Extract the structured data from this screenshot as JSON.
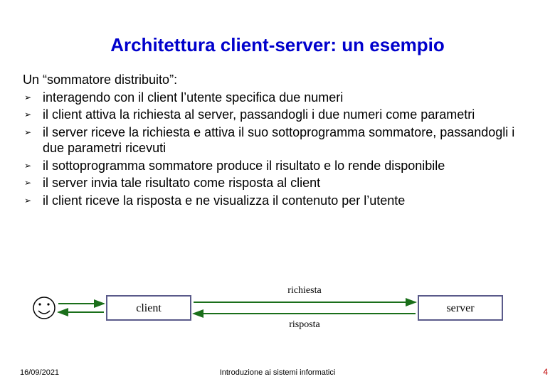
{
  "title": "Architettura client-server: un esempio",
  "intro": "Un “sommatore distribuito”:",
  "bullets": [
    "interagendo con il client l’utente specifica due numeri",
    "il client attiva la richiesta al server, passandogli i due numeri come parametri",
    "il server riceve la richiesta e attiva il suo sottoprogramma sommatore, passandogli i due parametri ricevuti",
    "il sottoprogramma sommatore produce il risultato e lo rende disponibile",
    "il server invia tale risultato come risposta al client",
    "il client riceve la risposta e ne visualizza il contenuto per l’utente"
  ],
  "diagram": {
    "client_label": "client",
    "server_label": "server",
    "request_label": "richiesta",
    "response_label": "risposta"
  },
  "footer": {
    "date": "16/09/2021",
    "center": "Introduzione ai sistemi informatici",
    "page": "4"
  }
}
